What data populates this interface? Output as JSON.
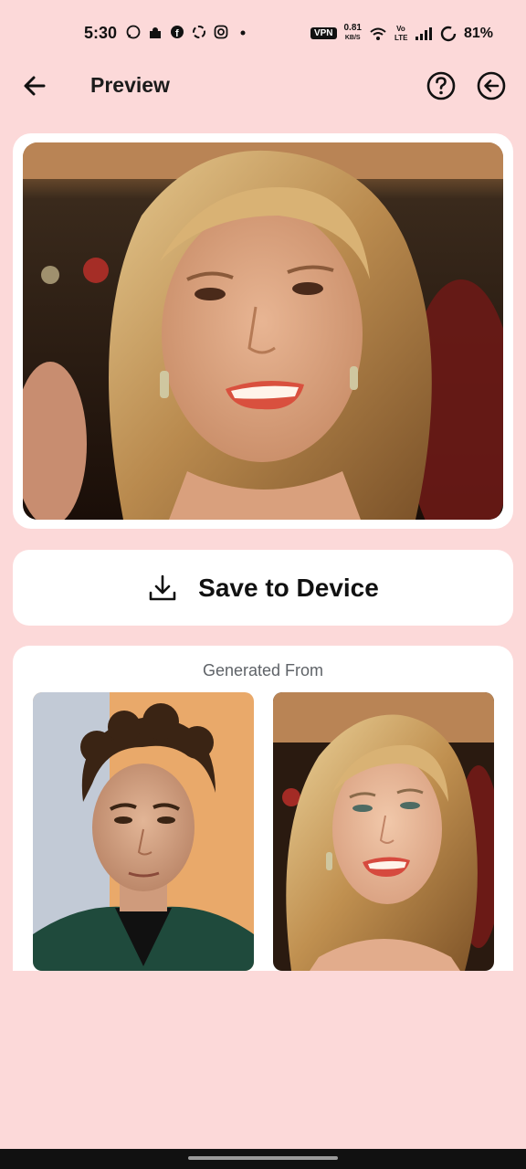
{
  "status_bar": {
    "time": "5:30",
    "vpn": "VPN",
    "speed_value": "0.81",
    "speed_unit": "KB/S",
    "volte": "Vo LTE",
    "battery": "81%"
  },
  "app_bar": {
    "title": "Preview",
    "back_icon": "arrow-left-icon",
    "help_icon": "help-circle-icon",
    "exit_icon": "circle-arrow-left-icon"
  },
  "save_button": {
    "label": "Save to Device",
    "icon": "download-icon"
  },
  "generated_from": {
    "title": "Generated From"
  },
  "colors": {
    "background": "#fcd9d9",
    "card": "#ffffff",
    "text": "#111111",
    "muted": "#5f6368"
  }
}
